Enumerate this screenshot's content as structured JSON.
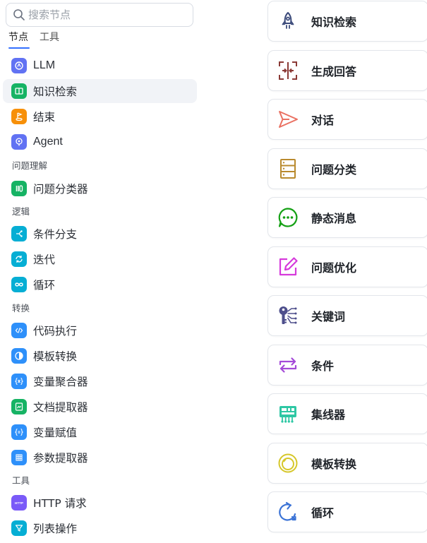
{
  "search": {
    "placeholder": "搜索节点"
  },
  "tabs": [
    {
      "label": "节点"
    },
    {
      "label": "工具"
    }
  ],
  "sections": {
    "understanding": "问题理解",
    "logic": "逻辑",
    "transform": "转换",
    "tools": "工具"
  },
  "nodes": {
    "llm": "LLM",
    "knowledge": "知识检索",
    "end": "结束",
    "agent": "Agent",
    "classifier": "问题分类器",
    "condition": "条件分支",
    "iteration": "迭代",
    "loop": "循环",
    "code": "代码执行",
    "template": "模板转换",
    "aggregator": "变量聚合器",
    "doc_extractor": "文档提取器",
    "assigner": "变量赋值",
    "param_extractor": "参数提取器",
    "http": "HTTP 请求",
    "list_op": "列表操作"
  },
  "icon_colors": {
    "llm": "#6172f3",
    "knowledge": "#16b364",
    "end": "#f79009",
    "agent": "#6172f3",
    "classifier": "#16b364",
    "logic": "#06aed4",
    "transform": "#2e90fa",
    "doc": "#16b364",
    "http": "#7a5af8",
    "list": "#06aed4"
  },
  "http_icon_text": "HTTP",
  "cards": [
    {
      "label": "知识检索",
      "icon": "rocket-icon"
    },
    {
      "label": "生成回答",
      "icon": "frame-icon"
    },
    {
      "label": "对话",
      "icon": "send-icon"
    },
    {
      "label": "问题分类",
      "icon": "stack-icon"
    },
    {
      "label": "静态消息",
      "icon": "message-icon"
    },
    {
      "label": "问题优化",
      "icon": "edit-icon"
    },
    {
      "label": "关键词",
      "icon": "keyword-icon"
    },
    {
      "label": "条件",
      "icon": "swap-icon"
    },
    {
      "label": "集线器",
      "icon": "hub-icon"
    },
    {
      "label": "模板转换",
      "icon": "template-icon"
    },
    {
      "label": "循环",
      "icon": "loop-icon"
    }
  ]
}
